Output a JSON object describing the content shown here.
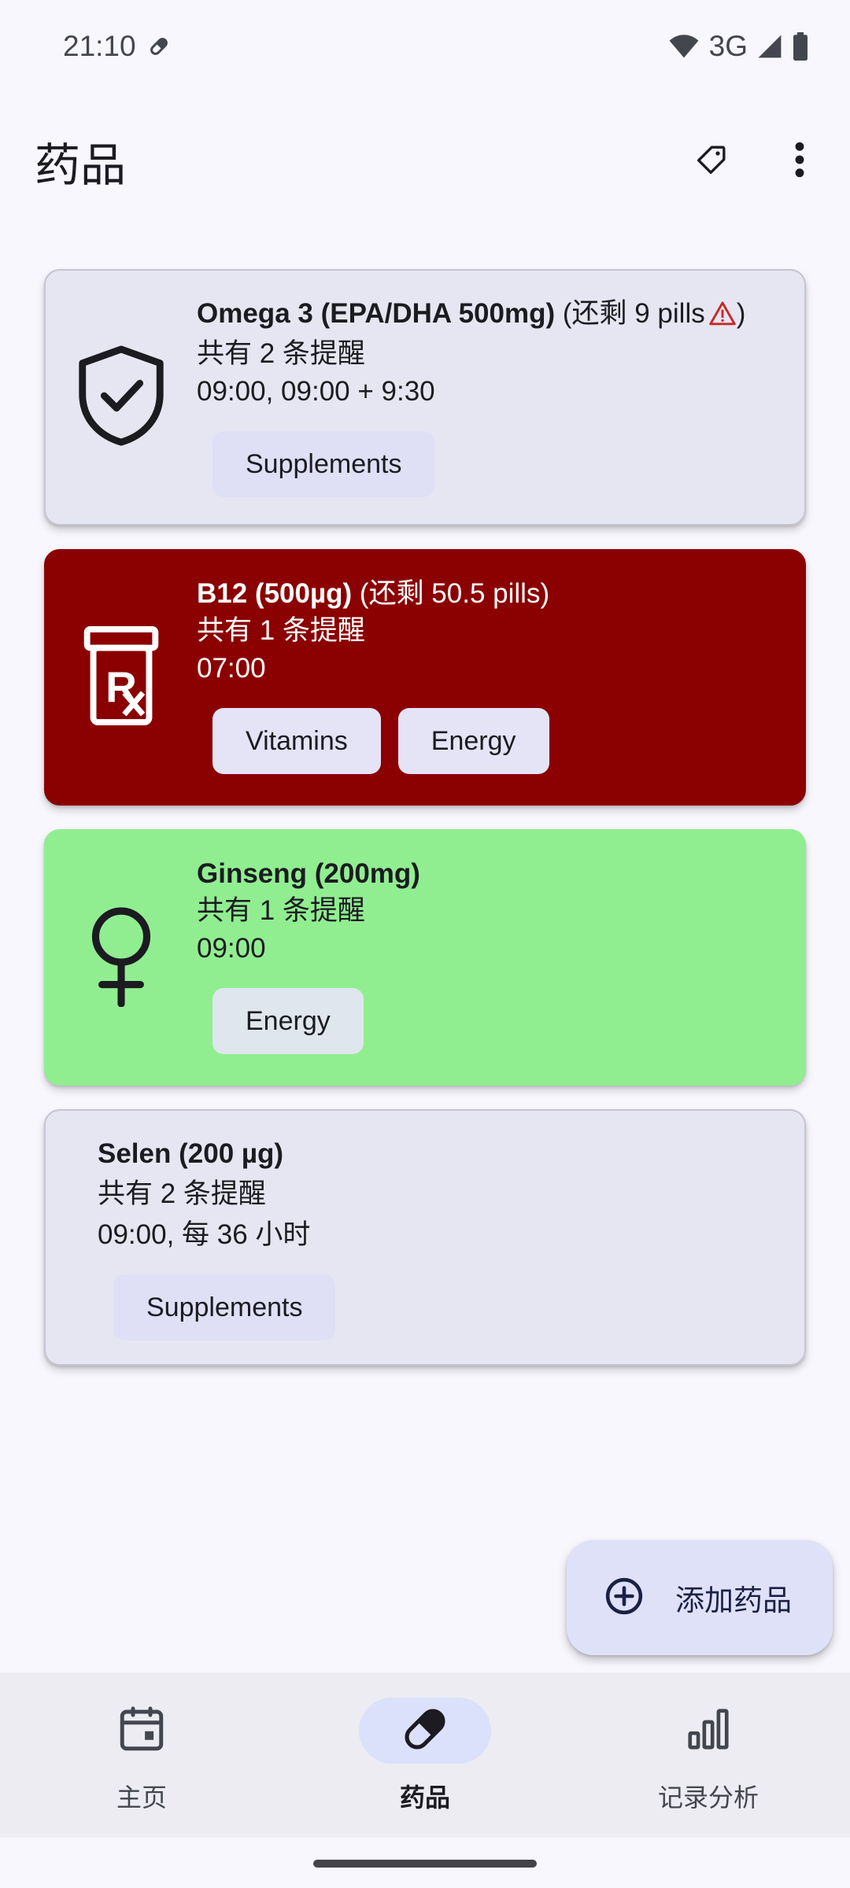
{
  "status_bar": {
    "time": "21:10",
    "network": "3G"
  },
  "app_bar": {
    "title": "药品"
  },
  "medicines": [
    {
      "name": "Omega 3 (EPA/DHA 500mg)",
      "stock_prefix": "(还剩 9 pills",
      "stock_suffix": ")",
      "low_stock_warning": true,
      "reminder_count": "共有 2 条提醒",
      "schedule": "09:00, 09:00 + 9:30",
      "icon": "shield-check-icon",
      "color": "#e6e6f2",
      "tags": [
        "Supplements"
      ]
    },
    {
      "name": "B12 (500µg)",
      "stock_prefix": "(还剩 50.5 pills)",
      "reminder_count": "共有 1 条提醒",
      "schedule": "07:00",
      "icon": "prescription-bottle-icon",
      "color": "#8b0000",
      "tags": [
        "Vitamins",
        "Energy"
      ]
    },
    {
      "name": "Ginseng (200mg)",
      "reminder_count": "共有 1 条提醒",
      "schedule": "09:00",
      "icon": "female-symbol-icon",
      "color": "#90ee90",
      "tags": [
        "Energy"
      ]
    },
    {
      "name": "Selen (200 µg)",
      "reminder_count": "共有 2 条提醒",
      "schedule": "09:00, 每 36 小时",
      "color": "#e6e6f2",
      "tags": [
        "Supplements"
      ]
    }
  ],
  "fab": {
    "label": "添加药品",
    "icon": "add-circle-icon"
  },
  "bottom_nav": {
    "items": [
      {
        "label": "主页",
        "icon": "calendar-icon",
        "active": false
      },
      {
        "label": "药品",
        "icon": "pill-icon",
        "active": true
      },
      {
        "label": "记录分析",
        "icon": "bar-chart-icon",
        "active": false
      }
    ]
  }
}
